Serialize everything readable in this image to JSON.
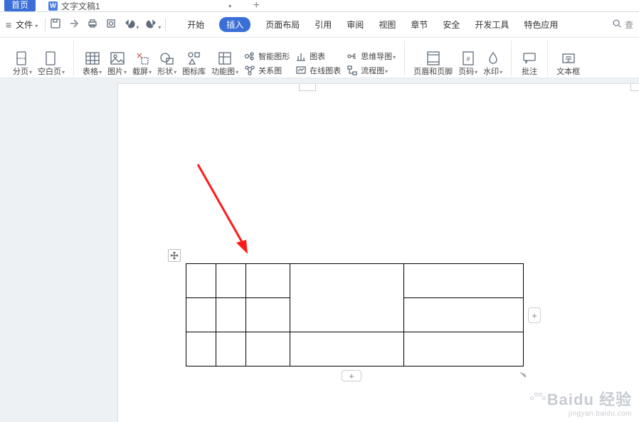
{
  "tabs": {
    "home": "首页",
    "doc": "文字文稿1",
    "doc_icon": "W"
  },
  "file_menu": "文件",
  "menu": {
    "start": "开始",
    "insert": "插入",
    "page_layout": "页面布局",
    "reference": "引用",
    "review": "审阅",
    "view": "视图",
    "section": "章节",
    "security": "安全",
    "dev_tools": "开发工具",
    "special": "特色应用"
  },
  "search_placeholder": "查",
  "ribbon": {
    "page_break": "分页",
    "blank_page": "空白页",
    "table": "表格",
    "picture": "图片",
    "screenshot": "截屏",
    "shapes": "形状",
    "icon_lib": "图标库",
    "func_chart": "功能图",
    "smart_art": "智能图形",
    "chart": "图表",
    "relation": "关系图",
    "online_chart": "在线图表",
    "mind_map": "思维导图",
    "flow_chart": "流程图",
    "header_footer": "页眉和页脚",
    "page_number": "页码",
    "watermark": "水印",
    "comment": "批注",
    "text_box": "文本框"
  },
  "watermark": {
    "main": "Baidu 经验",
    "sub": "jingyan.baidu.com"
  }
}
